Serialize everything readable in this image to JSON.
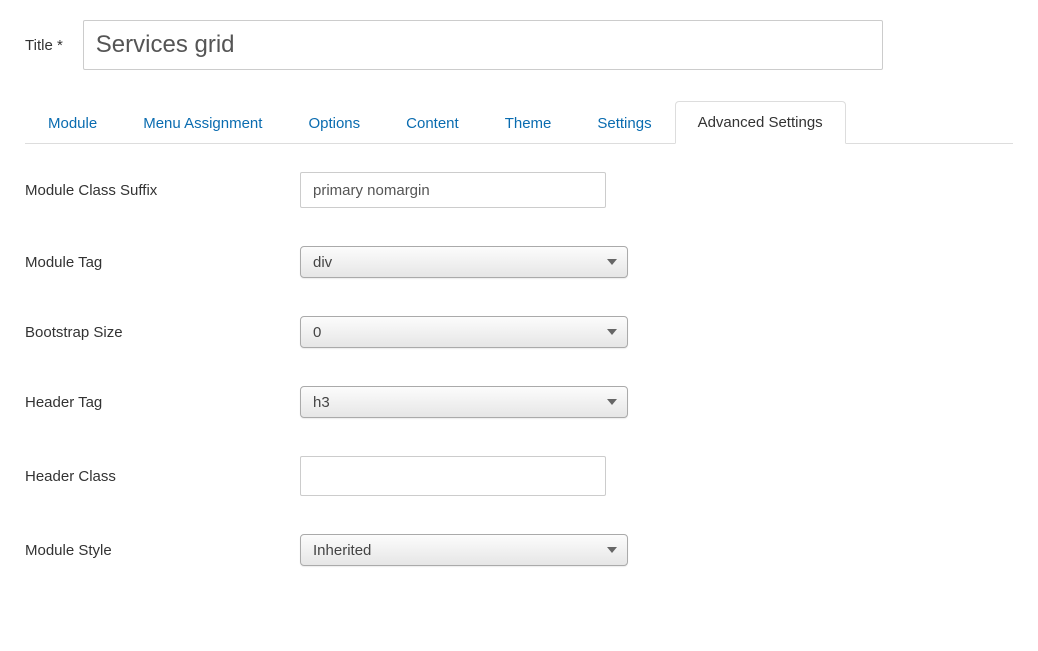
{
  "title": {
    "label": "Title *",
    "value": "Services grid"
  },
  "tabs": [
    {
      "label": "Module",
      "active": false
    },
    {
      "label": "Menu Assignment",
      "active": false
    },
    {
      "label": "Options",
      "active": false
    },
    {
      "label": "Content",
      "active": false
    },
    {
      "label": "Theme",
      "active": false
    },
    {
      "label": "Settings",
      "active": false
    },
    {
      "label": "Advanced Settings",
      "active": true
    }
  ],
  "fields": {
    "module_class_suffix": {
      "label": "Module Class Suffix",
      "value": "primary nomargin"
    },
    "module_tag": {
      "label": "Module Tag",
      "value": "div"
    },
    "bootstrap_size": {
      "label": "Bootstrap Size",
      "value": "0"
    },
    "header_tag": {
      "label": "Header Tag",
      "value": "h3"
    },
    "header_class": {
      "label": "Header Class",
      "value": ""
    },
    "module_style": {
      "label": "Module Style",
      "value": "Inherited"
    }
  }
}
